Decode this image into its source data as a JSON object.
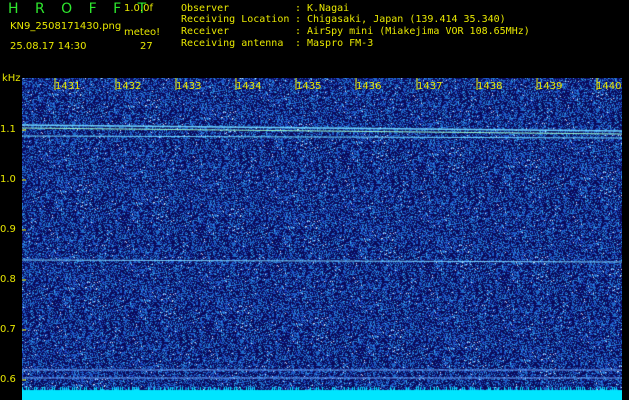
{
  "header": {
    "brand": "H R O F F T",
    "version": "1.0.0f",
    "filename": "KN9_2508171430.png",
    "meteo_label": "meteo!",
    "datetime": "25.08.17 14:30",
    "count": "27",
    "fields": [
      {
        "label": "Observer",
        "value": "K.Nagai"
      },
      {
        "label": "Receiving Location",
        "value": "Chigasaki, Japan (139.414 35.340)"
      },
      {
        "label": "Receiver",
        "value": "AirSpy mini (Miakejima VOR 108.65MHz)"
      },
      {
        "label": "Receiving antenna",
        "value": "Maspro FM-3"
      }
    ],
    "separator": ":"
  },
  "axes": {
    "unit": "kHz",
    "y_ticks": [
      "1.1",
      "1.0",
      "0.9",
      "0.8",
      "0.7",
      "0.6"
    ],
    "x_ticks": [
      "1431",
      "1432",
      "1433",
      "1434",
      "1435",
      "1436",
      "1437",
      "1438",
      "1439",
      "1440"
    ]
  },
  "colors": {
    "text": "#e8e800",
    "brand": "#2ee82e",
    "background": "#0a0a5a",
    "noise": "#3c6cff",
    "signal": "#8fe0ff",
    "floor": "#00e5ff"
  }
}
